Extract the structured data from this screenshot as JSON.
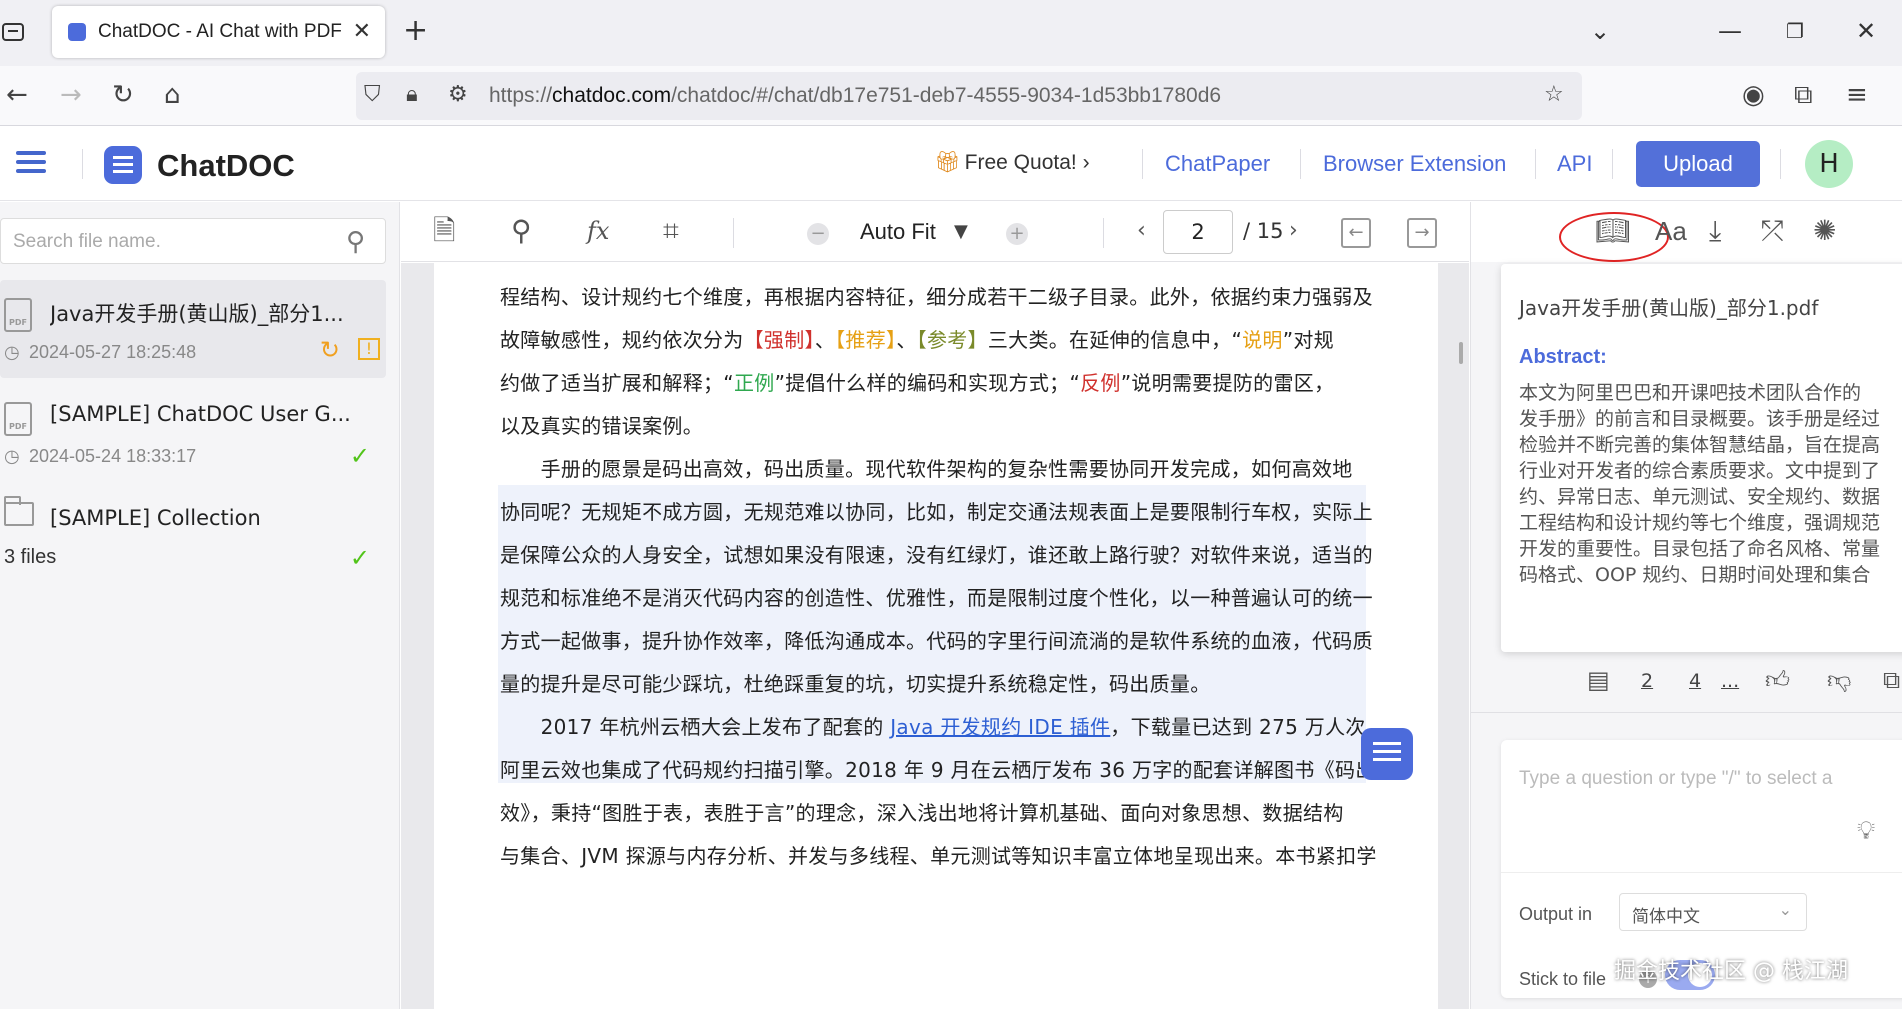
{
  "browser": {
    "tab_title": "ChatDOC - AI Chat with PDF",
    "url_prefix": "https://",
    "url_domain": "chatdoc.com",
    "url_path": "/chatdoc/#/chat/db17e751-deb7-4555-9034-1d53bb1780d6"
  },
  "header": {
    "logo": "ChatDOC",
    "quota": "Free Quota!",
    "links": [
      "ChatPaper",
      "Browser Extension",
      "API"
    ],
    "upload": "Upload",
    "avatar": "H",
    "accent_color": "#4c6bdb"
  },
  "sidebar": {
    "search_placeholder": "Search file name.",
    "files": [
      {
        "name": "Java开发手册(黄山版)_部分1...",
        "date": "2024-05-27 18:25:48",
        "status": "processing"
      },
      {
        "name": "[SAMPLE] ChatDOC User G...",
        "date": "2024-05-24 18:33:17",
        "status": "done"
      }
    ],
    "collection": {
      "name": "[SAMPLE] Collection",
      "count": "3 files",
      "status": "done"
    }
  },
  "pdf_toolbar": {
    "zoom": "Auto Fit",
    "page": "2",
    "total": "/ 15"
  },
  "pdf": {
    "lines": [
      "程结构、设计规约七个维度，再根据内容特征，细分成若干二级子目录。此外，依据约束力强弱及",
      "L2",
      "L3",
      "以及真实的错误案例。",
      "　　手册的愿景是码出高效，码出质量。现代软件架构的复杂性需要协同开发完成，如何高效地",
      "协同呢？无规矩不成方圆，无规范难以协同，比如，制定交通法规表面上是要限制行车权，实际上",
      "是保障公众的人身安全，试想如果没有限速，没有红绿灯，谁还敢上路行驶？对软件来说，适当的",
      "规范和标准绝不是消灭代码内容的创造性、优雅性，而是限制过度个性化，以一种普遍认可的统一",
      "方式一起做事，提升协作效率，降低沟通成本。代码的字里行间流淌的是软件系统的血液，代码质",
      "量的提升是尽可能少踩坑，杜绝踩重复的坑，切实提升系统稳定性，码出质量。",
      "L11",
      "阿里云效也集成了代码规约扫描引擎。2018 年 9 月在云栖厅发布 36 万字的配套详解图书《码出高",
      "效》，秉持“图胜于表，表胜于言”的理念，深入浅出地将计算机基础、面向对象思想、数据结构",
      "与集合、JVM 探源与内存分析、并发与多线程、单元测试等知识丰富立体地呈现出来。本书紧扣学"
    ],
    "l2": {
      "a": "故障敏感性，规约依次分为",
      "qiangzhi": "【强制】",
      "sep1": "、",
      "tuijian": "【推荐】",
      "sep2": "、",
      "cankao": "【参考】",
      "b": "三大类。在延伸的信息中，“",
      "shuoming": "说明",
      "c": "”对规"
    },
    "l3": {
      "a": "约做了适当扩展和解释；“",
      "zhengli": "正例",
      "b": "”提倡什么样的编码和实现方式；“",
      "fanli": "反例",
      "c": "”说明需要提防的雷区，"
    },
    "l11": {
      "a": "　　2017 年杭州云栖大会上发布了配套的 ",
      "link": "Java 开发规约 IDE 插件",
      "b": "，下载量已达到 275 万人次，"
    }
  },
  "right_panel": {
    "abstract_file": "Java开发手册(黄山版)_部分1.pdf",
    "abstract_label": "Abstract:",
    "abstract_lines": [
      "本文为阿里巴巴和开课吧技术团队合作的",
      "发手册》的前言和目录概要。该手册是经过",
      "检验并不断完善的集体智慧结晶，旨在提高",
      "行业对开发者的综合素质要求。文中提到了",
      "约、异常日志、单元测试、安全规约、数据",
      "工程结构和设计规约等七个维度，强调规范",
      "开发的重要性。目录包括了命名风格、常量",
      "码格式、OOP 规约、日期时间处理和集合"
    ],
    "refs": [
      "2",
      "4",
      "..."
    ],
    "question_placeholder": "Type a question or type \"/\" to select a",
    "output_label": "Output in",
    "output_value": "简体中文",
    "stick_label": "Stick to file"
  },
  "watermark": "掘金技术社区 @ 栈江湖"
}
